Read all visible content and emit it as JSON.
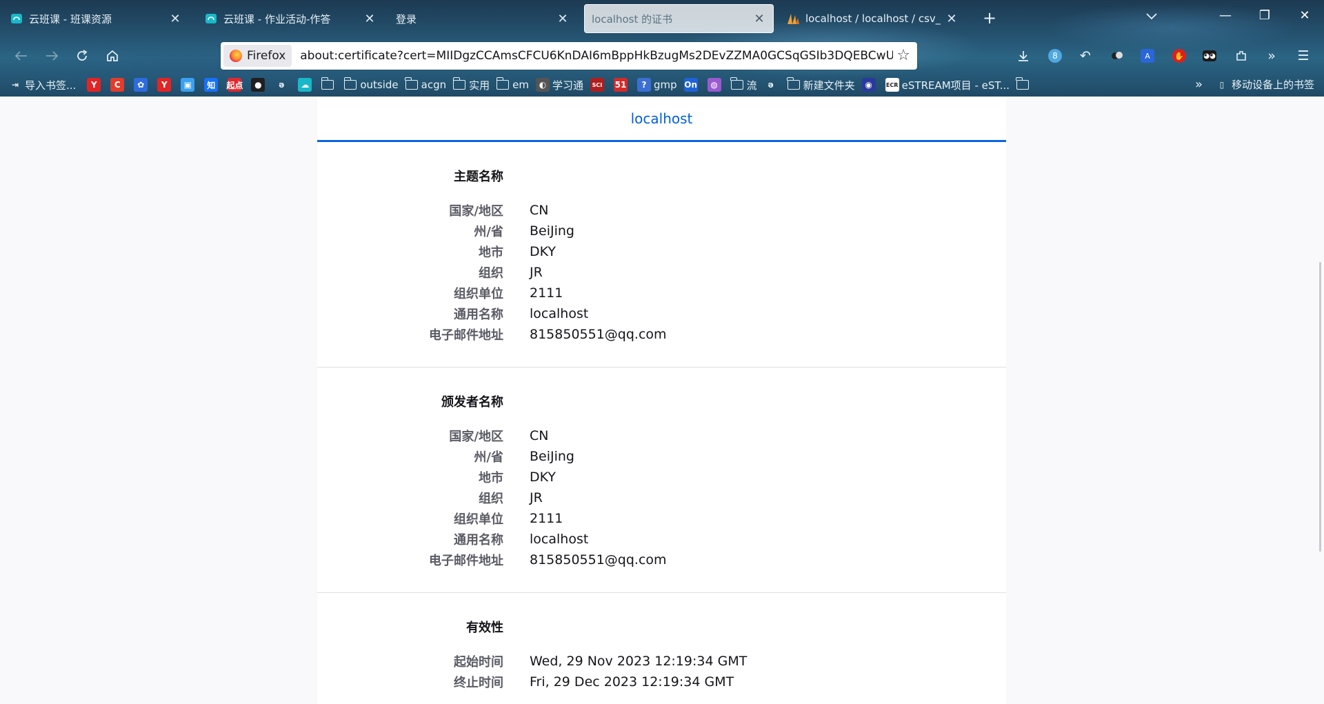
{
  "tabs": [
    {
      "title": "云班课 - 班课资源",
      "icon": "cloud-class-icon"
    },
    {
      "title": "云班课 - 作业活动-作答",
      "icon": "cloud-class-icon"
    },
    {
      "title": "登录",
      "icon": ""
    },
    {
      "title": "localhost 的证书",
      "icon": "",
      "active": true
    },
    {
      "title": "localhost / localhost / csv_db",
      "icon": "phpmyadmin-icon"
    }
  ],
  "navbar": {
    "identity_label": "Firefox",
    "url": "about:certificate?cert=MIIDgzCCAmsCFCU6KnDAI6mBppHkBzugMs2DEvZZMA0GCSqGSIb3DQEBCwUAMIGBMQswCQYDVQQGEwJDTjEQMA4GA1UECAwHQmVpSmluZzEMMAoGA1UEBwwDREtZ",
    "badge_count": "8"
  },
  "bookmarks": {
    "import_label": "导入书签...",
    "items": [
      {
        "type": "icon",
        "text": "Y",
        "color": "#e32424",
        "name": "yandex-icon"
      },
      {
        "type": "icon",
        "text": "C",
        "color": "#e33c2c",
        "name": "csdn-icon"
      },
      {
        "type": "icon",
        "text": "✿",
        "color": "#2d6cdf",
        "name": "baidu-icon"
      },
      {
        "type": "icon",
        "text": "Y",
        "color": "#e32424",
        "name": "y-icon"
      },
      {
        "type": "icon",
        "text": "▣",
        "color": "#3aa0f0",
        "name": "bilibili-icon"
      },
      {
        "type": "icon",
        "text": "知",
        "color": "#1772f6",
        "name": "zhihu-icon"
      },
      {
        "type": "icon",
        "text": "起点",
        "color": "#e0282e",
        "name": "qidian-icon"
      },
      {
        "type": "icon",
        "text": "●",
        "color": "#1f1f1f",
        "name": "github-icon"
      },
      {
        "type": "icon",
        "text": "ə",
        "color": "transparent",
        "name": "script-icon"
      },
      {
        "type": "icon",
        "text": "☁",
        "color": "#19b8c9",
        "name": "cloud-class-icon"
      },
      {
        "type": "folder",
        "text": ""
      },
      {
        "type": "folder",
        "text": "outside"
      },
      {
        "type": "folder",
        "text": "acgn"
      },
      {
        "type": "folder",
        "text": "实用"
      },
      {
        "type": "folder",
        "text": "em"
      },
      {
        "type": "icon",
        "text": "◐",
        "color": "#555555",
        "name": "xuexitong-icon",
        "label": "学习通"
      },
      {
        "type": "icon",
        "text": "SCI",
        "color": "#b01e1e",
        "name": "scihub-icon"
      },
      {
        "type": "icon",
        "text": "51",
        "color": "#d42a2a",
        "name": "51-icon"
      },
      {
        "type": "icon",
        "text": "?",
        "color": "#3b6fd4",
        "name": "gmp-icon",
        "label": "gmp"
      },
      {
        "type": "icon",
        "text": "On",
        "color": "#1f63d8",
        "name": "onenote-icon"
      },
      {
        "type": "icon",
        "text": "◍",
        "color": "#9b59d0",
        "name": "chat-icon"
      },
      {
        "type": "folder",
        "text": "流"
      },
      {
        "type": "icon",
        "text": "ə",
        "color": "transparent",
        "name": "script-icon-2"
      },
      {
        "type": "folder",
        "text": "新建文件夹"
      },
      {
        "type": "icon",
        "text": "◉",
        "color": "#2a3a9c",
        "name": "globe-icon"
      },
      {
        "type": "icon",
        "text": "ECR",
        "color": "#ffffff",
        "name": "estream-icon",
        "label": "eSTREAM项目 - eST..."
      },
      {
        "type": "folder",
        "text": ""
      }
    ],
    "mobile_label": "移动设备上的书签"
  },
  "certificate": {
    "tab_label": "localhost",
    "sections": [
      {
        "title": "主题名称",
        "rows": [
          {
            "key": "国家/地区",
            "value": "CN"
          },
          {
            "key": "州/省",
            "value": "BeiJing"
          },
          {
            "key": "地市",
            "value": "DKY"
          },
          {
            "key": "组织",
            "value": "JR"
          },
          {
            "key": "组织单位",
            "value": "2111"
          },
          {
            "key": "通用名称",
            "value": "localhost"
          },
          {
            "key": "电子邮件地址",
            "value": "815850551@qq.com"
          }
        ]
      },
      {
        "title": "颁发者名称",
        "rows": [
          {
            "key": "国家/地区",
            "value": "CN"
          },
          {
            "key": "州/省",
            "value": "BeiJing"
          },
          {
            "key": "地市",
            "value": "DKY"
          },
          {
            "key": "组织",
            "value": "JR"
          },
          {
            "key": "组织单位",
            "value": "2111"
          },
          {
            "key": "通用名称",
            "value": "localhost"
          },
          {
            "key": "电子邮件地址",
            "value": "815850551@qq.com"
          }
        ]
      },
      {
        "title": "有效性",
        "rows": [
          {
            "key": "起始时间",
            "value": "Wed, 29 Nov 2023 12:19:34 GMT"
          },
          {
            "key": "终止时间",
            "value": "Fri, 29 Dec 2023 12:19:34 GMT"
          }
        ]
      }
    ]
  }
}
